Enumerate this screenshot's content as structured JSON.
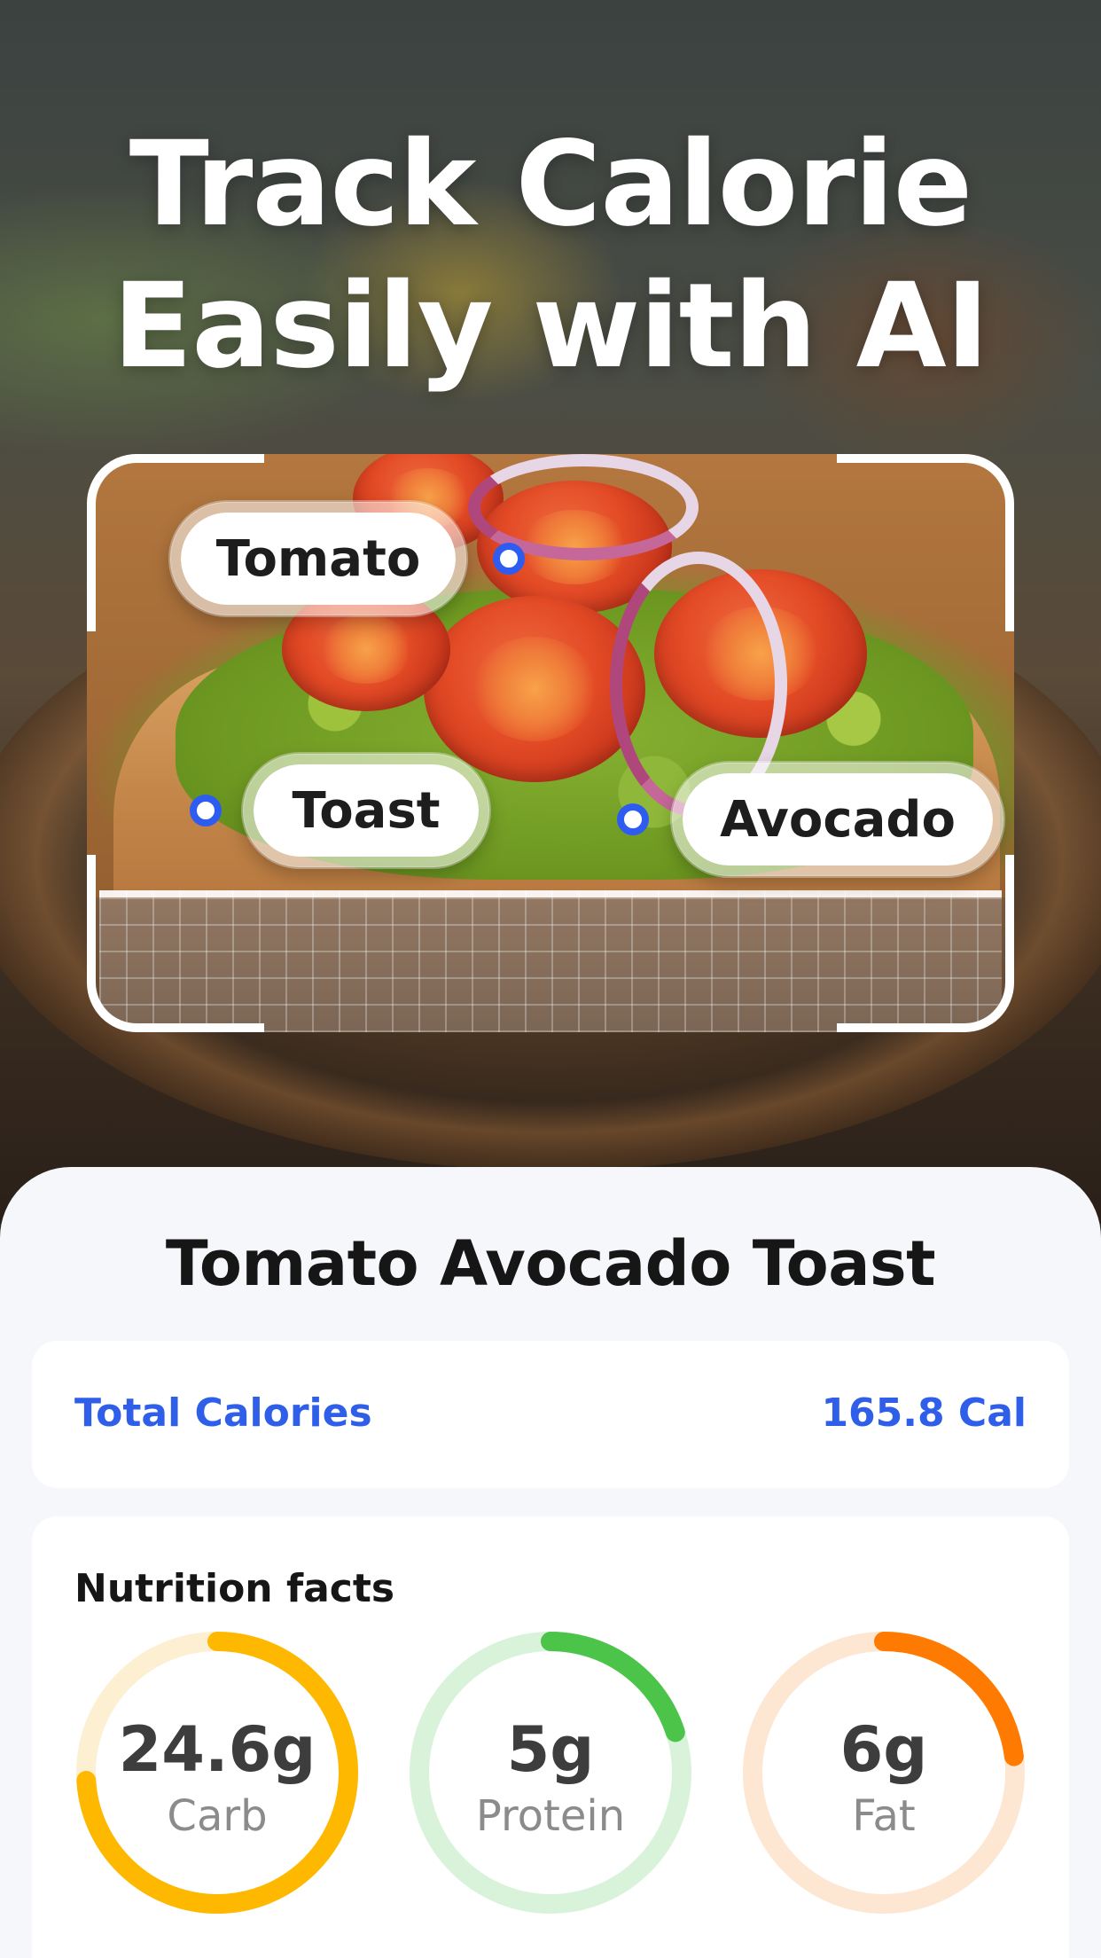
{
  "headline": {
    "line1": "Track Calorie",
    "line2": "Easily with AI"
  },
  "scan": {
    "tags": [
      {
        "label": "Tomato"
      },
      {
        "label": "Toast"
      },
      {
        "label": "Avocado"
      }
    ]
  },
  "result": {
    "dish_name": "Tomato Avocado Toast",
    "total_calories_label": "Total Calories",
    "total_calories_value": "165.8 Cal",
    "nutrition_title": "Nutrition facts",
    "nutrients": [
      {
        "value": "24.6g",
        "label": "Carb",
        "progress": 0.74,
        "color": "#ffb800",
        "track": "#fdf0d2"
      },
      {
        "value": "5g",
        "label": "Protein",
        "progress": 0.2,
        "color": "#4cc44a",
        "track": "#d9f3da"
      },
      {
        "value": "6g",
        "label": "Fat",
        "progress": 0.23,
        "color": "#ff7a00",
        "track": "#fde7d3"
      }
    ]
  },
  "colors": {
    "accent": "#2f5ee8",
    "sheet_background": "#f6f7fb"
  }
}
